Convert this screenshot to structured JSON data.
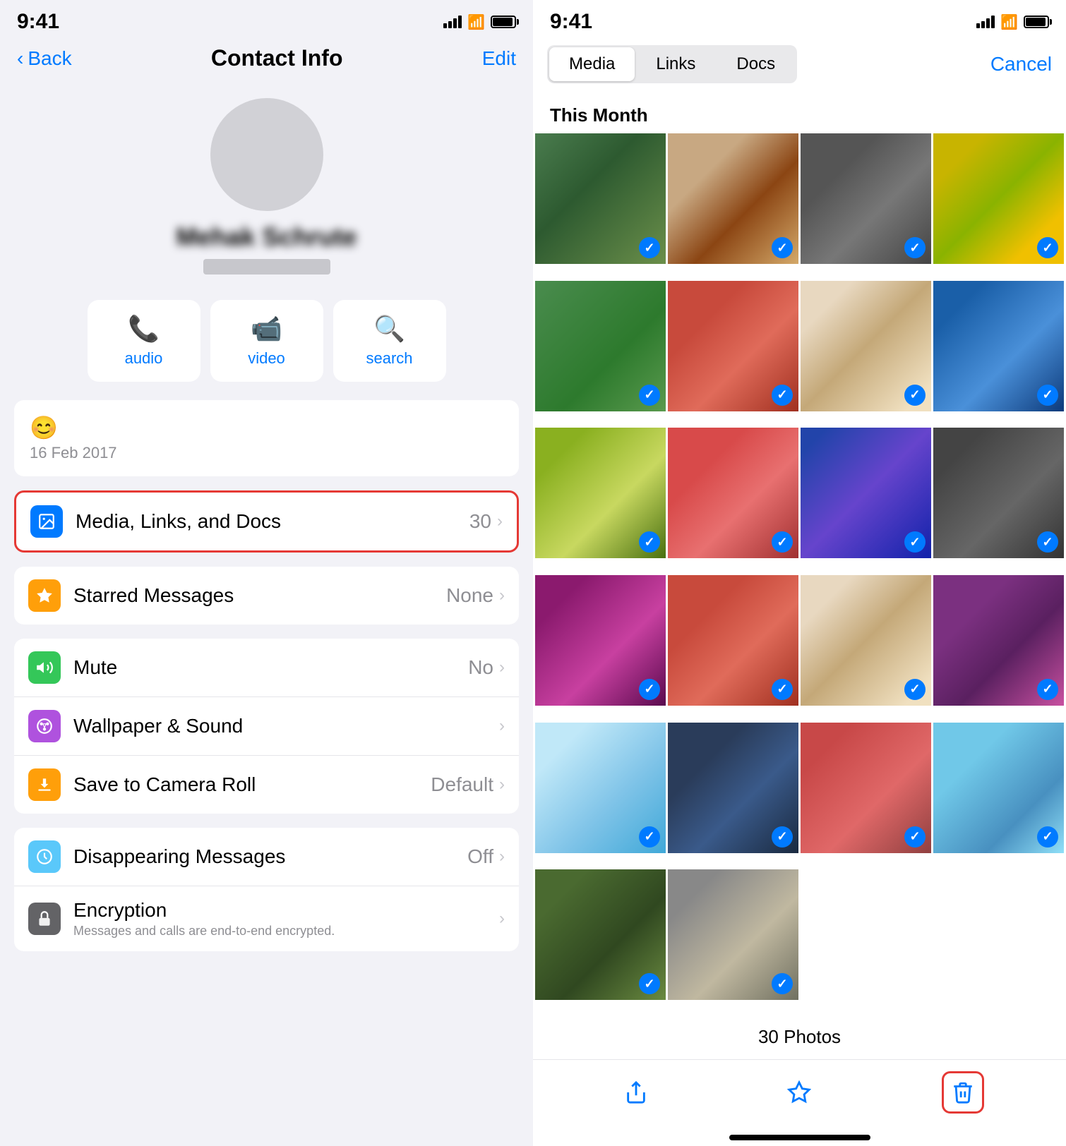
{
  "left": {
    "status": {
      "time": "9:41"
    },
    "nav": {
      "back": "Back",
      "title": "Contact Info",
      "edit": "Edit"
    },
    "contact": {
      "name": "Mehak Schrute",
      "date": "16 Feb 2017",
      "emoji": "😊"
    },
    "actions": {
      "audio": "audio",
      "video": "video",
      "search": "search"
    },
    "mediaRow": {
      "label": "Media, Links, and Docs",
      "value": "30"
    },
    "starredRow": {
      "label": "Starred Messages",
      "value": "None"
    },
    "muteRow": {
      "label": "Mute",
      "value": "No"
    },
    "wallpaperRow": {
      "label": "Wallpaper & Sound"
    },
    "saveRow": {
      "label": "Save to Camera Roll",
      "value": "Default"
    },
    "disappearRow": {
      "label": "Disappearing Messages",
      "value": "Off"
    },
    "encryptionRow": {
      "label": "Encryption",
      "sub": "Messages and calls are end-to-end encrypted."
    }
  },
  "right": {
    "status": {
      "time": "9:41"
    },
    "tabs": {
      "media": "Media",
      "links": "Links",
      "docs": "Docs",
      "cancel": "Cancel"
    },
    "sectionHeader": "This Month",
    "photosCount": "30 Photos",
    "toolbar": {
      "share": "share",
      "star": "star",
      "delete": "delete"
    }
  }
}
